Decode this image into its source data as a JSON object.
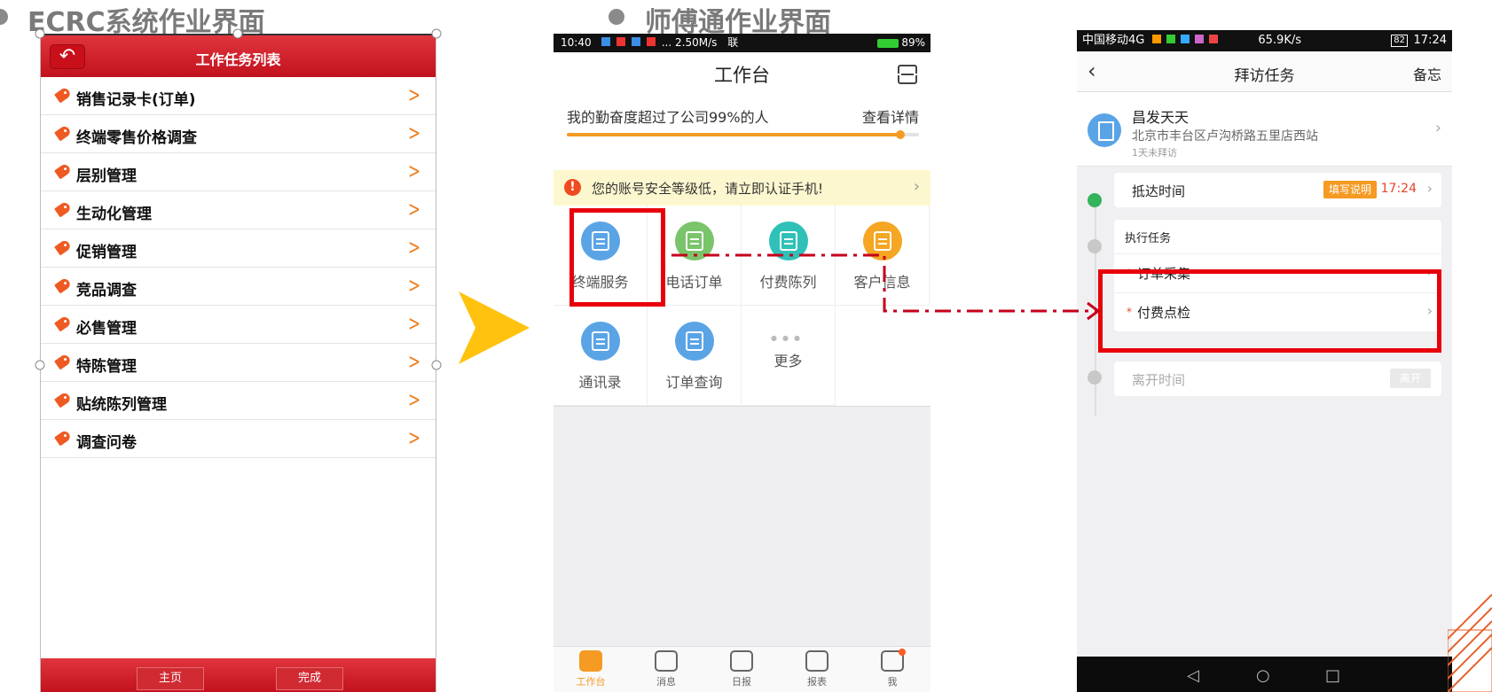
{
  "section_titles": {
    "ecrc": "ECRC系统作业界面",
    "sft": "师傅通作业界面"
  },
  "ecrc": {
    "back_icon": "undo-arrow-icon",
    "title": "工作任务列表",
    "items": [
      {
        "label": "销售记录卡(订单)"
      },
      {
        "label": "终端零售价格调查"
      },
      {
        "label": "层别管理"
      },
      {
        "label": "生动化管理"
      },
      {
        "label": "促销管理"
      },
      {
        "label": "竞品调查"
      },
      {
        "label": "必售管理"
      },
      {
        "label": "特陈管理"
      },
      {
        "label": "贴统陈列管理"
      },
      {
        "label": "调查问卷"
      }
    ],
    "footer": {
      "home": "主页",
      "done": "完成"
    },
    "colors": {
      "header": "#d21e28",
      "chevron": "#ee7d1c",
      "tag": "#ef5a23"
    }
  },
  "sft": {
    "status": {
      "time": "10:40",
      "speed": "... 2.50M/s",
      "carrier": "联",
      "battery": "89%"
    },
    "title": "工作台",
    "progress_text": "我的勤奋度超过了公司99%的人",
    "progress_link": "查看详情",
    "progress_pct": 0.95,
    "alert": "您的账号安全等级低，请立即认证手机!",
    "grid": [
      {
        "label": "终端服务",
        "icon": "handshake-icon",
        "color": "#5aa4e6"
      },
      {
        "label": "电话订单",
        "icon": "clipboard-icon",
        "color": "#7ac46b"
      },
      {
        "label": "付费陈列",
        "icon": "tag-icon",
        "color": "#2fc1b8"
      },
      {
        "label": "客户信息",
        "icon": "store-icon",
        "color": "#f5a623"
      },
      {
        "label": "通讯录",
        "icon": "contacts-icon",
        "color": "#5aa4e6"
      },
      {
        "label": "订单查询",
        "icon": "document-icon",
        "color": "#5aa4e6"
      },
      {
        "label": "更多",
        "icon": "more-dots-icon",
        "color": ""
      }
    ],
    "tabs": [
      {
        "label": "工作台",
        "icon": "workbench-icon",
        "active": true
      },
      {
        "label": "消息",
        "icon": "chat-icon",
        "active": false
      },
      {
        "label": "日报",
        "icon": "report-doc-icon",
        "active": false
      },
      {
        "label": "报表",
        "icon": "chart-icon",
        "active": false
      },
      {
        "label": "我",
        "icon": "user-icon",
        "active": false
      }
    ],
    "accent": "#f59a23"
  },
  "visit": {
    "status": {
      "carrier": "中国移动4G",
      "speed": "65.9K/s",
      "battery": "82",
      "time": "17:24"
    },
    "title": "拜访任务",
    "memo": "备忘",
    "store": {
      "name": "昌发天天",
      "address": "北京市丰台区卢沟桥路五里店西站",
      "note": "1天未拜访"
    },
    "arrive": {
      "label": "抵达时间",
      "fill_btn": "填写说明",
      "time": "17:24"
    },
    "exec": {
      "label": "执行任务",
      "tasks": [
        "订单采集",
        "付费点检"
      ]
    },
    "leave": {
      "label": "离开时间",
      "button": "离开"
    }
  }
}
